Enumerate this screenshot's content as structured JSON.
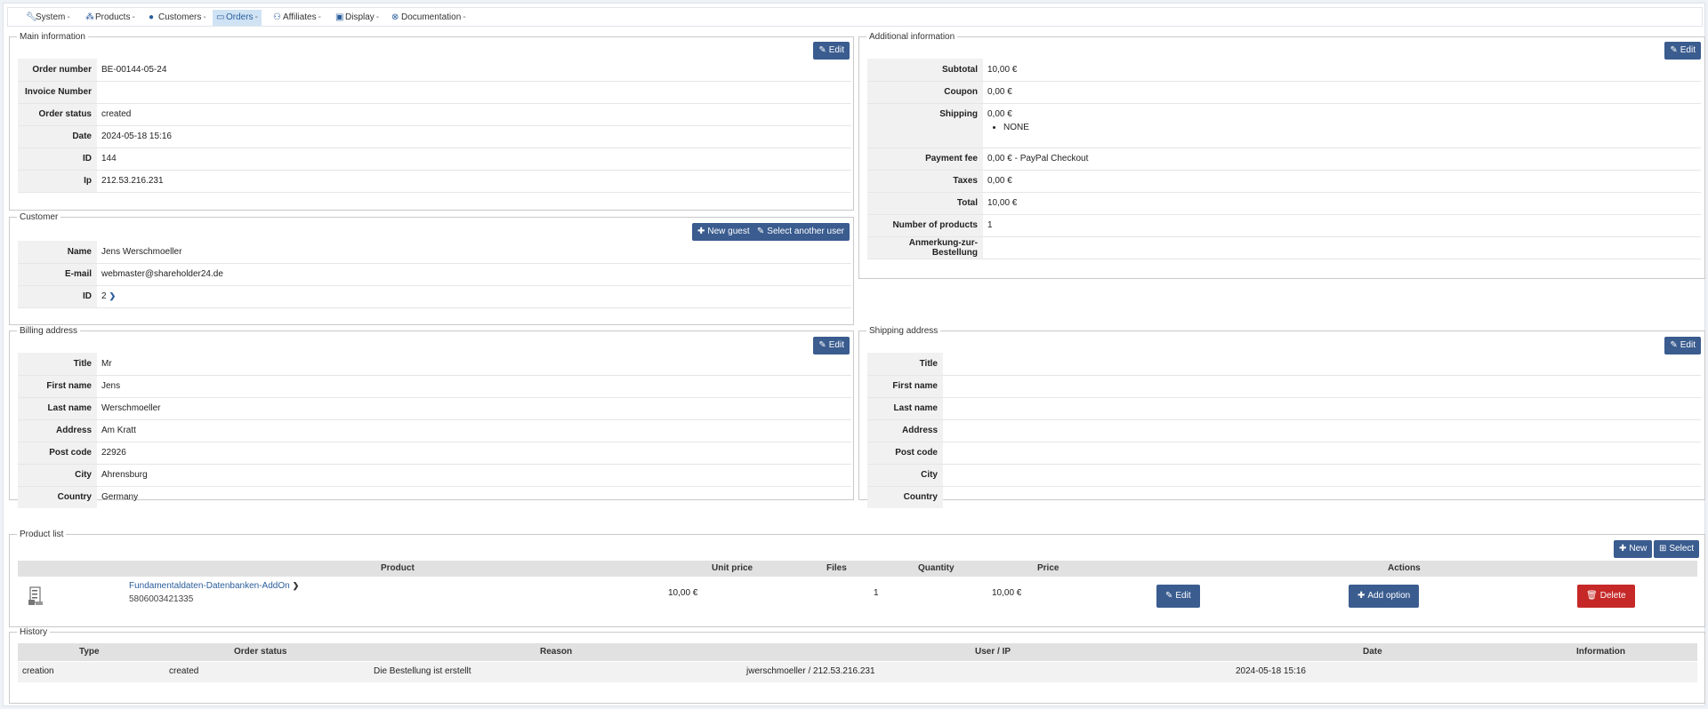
{
  "nav": {
    "items": [
      {
        "icon": "wrench-icon",
        "label": "System"
      },
      {
        "icon": "cubes-icon",
        "label": "Products"
      },
      {
        "icon": "user-icon",
        "label": "Customers"
      },
      {
        "icon": "credit-card-icon",
        "label": "Orders"
      },
      {
        "icon": "users-icon",
        "label": "Affiliates"
      },
      {
        "icon": "monitor-icon",
        "label": "Display"
      },
      {
        "icon": "support-icon",
        "label": "Documentation"
      }
    ],
    "caret": "-",
    "active": "Orders"
  },
  "main_info": {
    "legend": "Main information",
    "edit_label": "Edit",
    "rows": [
      {
        "key": "Order number",
        "value": "BE-00144-05-24"
      },
      {
        "key": "Invoice Number",
        "value": ""
      },
      {
        "key": "Order status",
        "value": "created"
      },
      {
        "key": "Date",
        "value": "2024-05-18 15:16"
      },
      {
        "key": "ID",
        "value": "144"
      },
      {
        "key": "Ip",
        "value": "212.53.216.231"
      }
    ]
  },
  "additional_info": {
    "legend": "Additional information",
    "edit_label": "Edit",
    "subtotal_key": "Subtotal",
    "subtotal": "10,00 €",
    "coupon_key": "Coupon",
    "coupon": "0,00 €",
    "shipping_key": "Shipping",
    "shipping": "0,00 €",
    "shipping_method": "NONE",
    "payment_fee_key": "Payment fee",
    "payment_fee": "0,00 € - PayPal Checkout",
    "taxes_key": "Taxes",
    "taxes": "0,00 €",
    "total_key": "Total",
    "total": "10,00 €",
    "num_products_key": "Number of products",
    "num_products": "1",
    "note_key": "Anmerkung-zur-Bestellung",
    "note": ""
  },
  "customer": {
    "legend": "Customer",
    "new_guest_label": "New guest",
    "select_user_label": "Select another user",
    "name_key": "Name",
    "name": "Jens Werschmoeller",
    "email_key": "E-mail",
    "email": "webmaster@shareholder24.de",
    "id_key": "ID",
    "id": "2"
  },
  "billing": {
    "legend": "Billing address",
    "edit_label": "Edit",
    "rows": [
      {
        "key": "Title",
        "value": "Mr"
      },
      {
        "key": "First name",
        "value": "Jens"
      },
      {
        "key": "Last name",
        "value": "Werschmoeller"
      },
      {
        "key": "Address",
        "value": "Am Kratt"
      },
      {
        "key": "Post code",
        "value": "22926"
      },
      {
        "key": "City",
        "value": "Ahrensburg"
      },
      {
        "key": "Country",
        "value": "Germany"
      }
    ]
  },
  "shipping": {
    "legend": "Shipping address",
    "edit_label": "Edit",
    "rows": [
      {
        "key": "Title",
        "value": ""
      },
      {
        "key": "First name",
        "value": ""
      },
      {
        "key": "Last name",
        "value": ""
      },
      {
        "key": "Address",
        "value": ""
      },
      {
        "key": "Post code",
        "value": ""
      },
      {
        "key": "City",
        "value": ""
      },
      {
        "key": "Country",
        "value": ""
      }
    ]
  },
  "products": {
    "legend": "Product list",
    "new_label": "New",
    "select_label": "Select",
    "headers": {
      "product": "Product",
      "unit_price": "Unit price",
      "files": "Files",
      "quantity": "Quantity",
      "price": "Price",
      "actions": "Actions"
    },
    "row": {
      "name": "Fundamentaldaten-Datenbanken-AddOn",
      "code": "5806003421335",
      "unit_price": "10,00 €",
      "files": "",
      "quantity": "1",
      "price": "10,00 €",
      "edit_label": "Edit",
      "add_option_label": "Add option",
      "delete_label": "Delete"
    }
  },
  "history": {
    "legend": "History",
    "headers": {
      "type": "Type",
      "order_status": "Order status",
      "reason": "Reason",
      "user_ip": "User / IP",
      "date": "Date",
      "information": "Information"
    },
    "row": {
      "type": "creation",
      "order_status": "created",
      "reason": "Die Bestellung ist erstellt",
      "user_ip": "jwerschmoeller / 212.53.216.231",
      "date": "2024-05-18 15:16",
      "information": ""
    }
  },
  "colors": {
    "primary": "#3a5c8f",
    "danger": "#c62828",
    "active_nav": "#cfe3f5",
    "link": "#2a5d9b"
  }
}
